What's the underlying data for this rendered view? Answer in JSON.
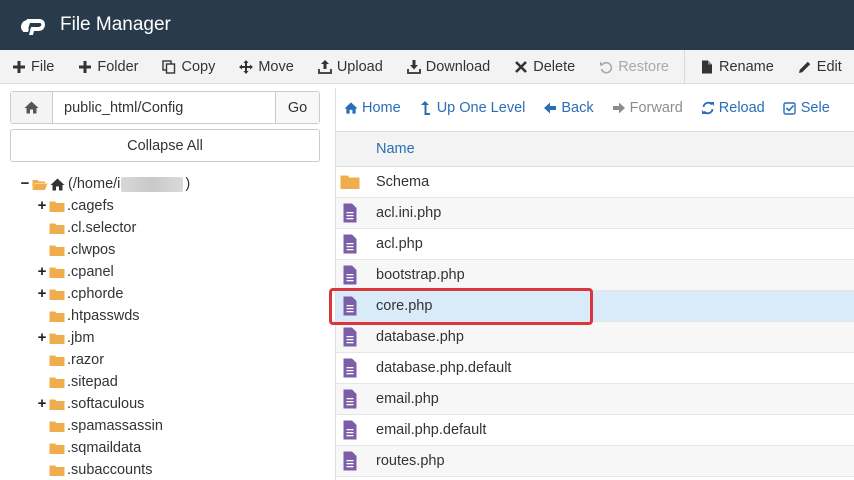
{
  "app": {
    "title": "File Manager"
  },
  "toolbar": {
    "file": "File",
    "folder": "Folder",
    "copy": "Copy",
    "move": "Move",
    "upload": "Upload",
    "download": "Download",
    "delete": "Delete",
    "restore": "Restore",
    "rename": "Rename",
    "edit": "Edit"
  },
  "left": {
    "path": "public_html/Config",
    "go": "Go",
    "collapse_all": "Collapse All",
    "tree_root_prefix": "(/home/i",
    "tree_root_suffix": ")",
    "tree": [
      {
        "label": ".cagefs",
        "expandable": true
      },
      {
        "label": ".cl.selector",
        "expandable": false
      },
      {
        "label": ".clwpos",
        "expandable": false
      },
      {
        "label": ".cpanel",
        "expandable": true
      },
      {
        "label": ".cphorde",
        "expandable": true
      },
      {
        "label": ".htpasswds",
        "expandable": false
      },
      {
        "label": ".jbm",
        "expandable": true
      },
      {
        "label": ".razor",
        "expandable": false
      },
      {
        "label": ".sitepad",
        "expandable": false
      },
      {
        "label": ".softaculous",
        "expandable": true
      },
      {
        "label": ".spamassassin",
        "expandable": false
      },
      {
        "label": ".sqmaildata",
        "expandable": false
      },
      {
        "label": ".subaccounts",
        "expandable": false
      }
    ]
  },
  "nav": {
    "home": "Home",
    "up": "Up One Level",
    "back": "Back",
    "forward": "Forward",
    "reload": "Reload",
    "select": "Sele"
  },
  "files": {
    "header_name": "Name",
    "rows": [
      {
        "name": "Schema",
        "type": "folder"
      },
      {
        "name": "acl.ini.php",
        "type": "file"
      },
      {
        "name": "acl.php",
        "type": "file"
      },
      {
        "name": "bootstrap.php",
        "type": "file"
      },
      {
        "name": "core.php",
        "type": "file",
        "selected": true
      },
      {
        "name": "database.php",
        "type": "file"
      },
      {
        "name": "database.php.default",
        "type": "file"
      },
      {
        "name": "email.php",
        "type": "file"
      },
      {
        "name": "email.php.default",
        "type": "file"
      },
      {
        "name": "routes.php",
        "type": "file"
      }
    ]
  },
  "colors": {
    "header_bg": "#293a4a",
    "link": "#2a6fb6",
    "folder": "#f0ad4e",
    "file_icon": "#7b5ea7",
    "selected_row": "#d9ebf9",
    "highlight": "#d9363e"
  }
}
